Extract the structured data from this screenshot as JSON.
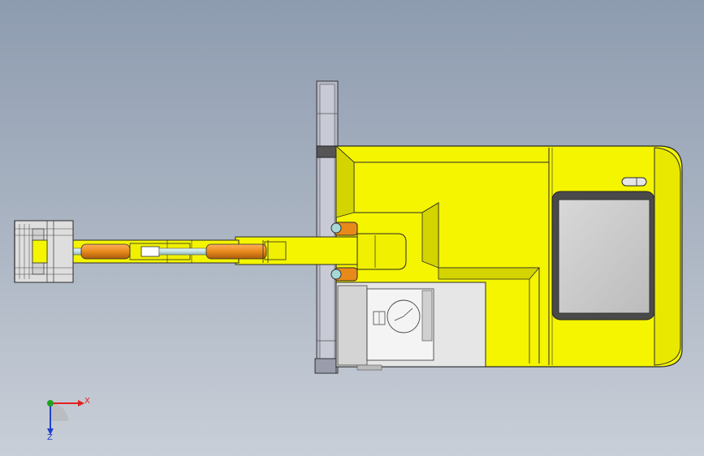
{
  "colors": {
    "body_yellow": "#f5f500",
    "body_yellow_shade": "#c9c900",
    "outline": "#2a2a2a",
    "track_gray": "#b9b9c6",
    "window_gray": "#c8c8c8",
    "cylinder_orange": "#e88a1a",
    "rod_blue": "#cfe9ea",
    "axis_x": "#e02020",
    "axis_y": "#20a020",
    "axis_z": "#2040d0"
  },
  "triad": {
    "x_label": "X",
    "z_label": "Z",
    "icon": "coordinate-triad-icon"
  }
}
